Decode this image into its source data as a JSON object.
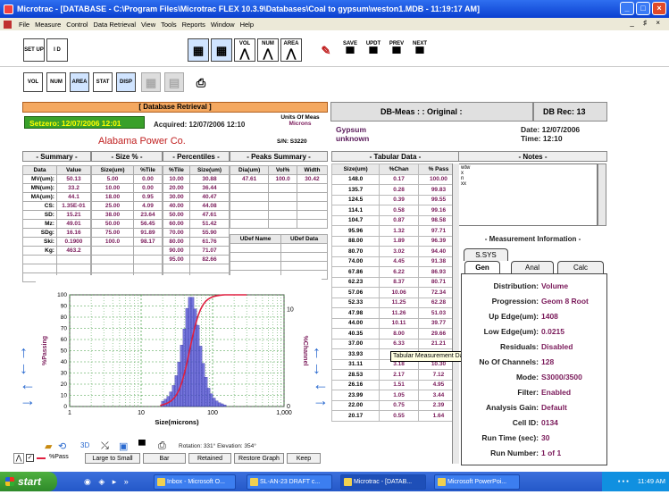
{
  "window": {
    "title": "Microtrac - [DATABASE - C:\\Program Files\\Microtrac FLEX 10.3.9\\Databases\\Coal to gypsum\\weston1.MDB - 11:19:17 AM]"
  },
  "menu": [
    "File",
    "Measure",
    "Control",
    "Data Retrieval",
    "View",
    "Tools",
    "Reports",
    "Window",
    "Help"
  ],
  "mdi_controls": "_ ♯ ×",
  "toolbar1": {
    "setup": "SET UP",
    "id": "I D",
    "vol": "VOL",
    "num": "NUM",
    "area": "AREA",
    "save": "SAVE",
    "updt": "UPDT",
    "prev": "PREV",
    "next": "NEXT"
  },
  "toolbar2": {
    "vol2": "VOL",
    "num2": "NUM",
    "area2": "AREA",
    "stat": "STAT",
    "disp": "DISP"
  },
  "database": {
    "header": "[ Database Retrieval ]",
    "setzero": "Setzero: 12/07/2006 12:01",
    "acquired": "Acquired: 12/07/2006  12:10",
    "units": "Units Of Meas",
    "units_value": "Microns",
    "company": "Alabama Power Co.",
    "sn": "S/N: S3220"
  },
  "sections": {
    "summary": "- Summary -",
    "size": "- Size % -",
    "percentiles": "- Percentiles -",
    "peaks": "- Peaks Summary -"
  },
  "summary": {
    "headers": [
      "Data",
      "Value"
    ],
    "rows": [
      [
        "MV(um):",
        "50.13"
      ],
      [
        "MN(um):",
        "33.2"
      ],
      [
        "MA(um):",
        "44.1"
      ],
      [
        "CS:",
        "1.35E-01"
      ],
      [
        "SD:",
        "15.21"
      ],
      [
        "Mz:",
        "49.01"
      ],
      [
        "SDg:",
        "16.16"
      ],
      [
        "Ski:",
        "0.1900"
      ],
      [
        "Kg:",
        "463.2"
      ]
    ]
  },
  "sizepct": {
    "headers": [
      "Size(um)",
      "%Tile"
    ],
    "rows": [
      [
        "5.00",
        "0.00"
      ],
      [
        "10.00",
        "0.00"
      ],
      [
        "18.00",
        "0.95"
      ],
      [
        "25.00",
        "4.09"
      ],
      [
        "38.00",
        "23.64"
      ],
      [
        "50.00",
        "56.45"
      ],
      [
        "75.00",
        "91.89"
      ],
      [
        "100.0",
        "98.17"
      ]
    ]
  },
  "percentiles": {
    "headers": [
      "%Tile",
      "Size(um)"
    ],
    "rows": [
      [
        "10.00",
        "30.88"
      ],
      [
        "20.00",
        "36.44"
      ],
      [
        "30.00",
        "40.47"
      ],
      [
        "40.00",
        "44.08"
      ],
      [
        "50.00",
        "47.61"
      ],
      [
        "60.00",
        "51.42"
      ],
      [
        "70.00",
        "55.90"
      ],
      [
        "80.00",
        "61.76"
      ],
      [
        "90.00",
        "71.07"
      ],
      [
        "95.00",
        "82.66"
      ]
    ]
  },
  "peaks": {
    "headers": [
      "Dia(um)",
      "Vol%",
      "Width"
    ],
    "rows": [
      [
        "47.61",
        "100.0",
        "30.42"
      ]
    ],
    "udef_headers": [
      "UDef Name",
      "UDef Data"
    ]
  },
  "right": {
    "dbmeas": "DB-Meas : : Original :",
    "dbrec": "DB Rec:  13",
    "sample1": "Gypsum",
    "sample2": "unknown",
    "date": "Date: 12/07/2006",
    "time": "Time: 12:10",
    "tabular_title": "- Tabular Data -",
    "notes_title": "- Notes -",
    "notes_lines": [
      "wtw",
      "x",
      "n",
      "xx"
    ]
  },
  "tabular": {
    "headers": [
      "Size(um)",
      "%Chan",
      "% Pass"
    ],
    "rows": [
      [
        "148.0",
        "0.17",
        "100.00"
      ],
      [
        "135.7",
        "0.28",
        "99.83"
      ],
      [
        "124.5",
        "0.39",
        "99.55"
      ],
      [
        "114.1",
        "0.58",
        "99.16"
      ],
      [
        "104.7",
        "0.87",
        "98.58"
      ],
      [
        "95.96",
        "1.32",
        "97.71"
      ],
      [
        "88.00",
        "1.89",
        "96.39"
      ],
      [
        "80.70",
        "3.02",
        "94.40"
      ],
      [
        "74.00",
        "4.45",
        "91.38"
      ],
      [
        "67.86",
        "6.22",
        "86.93"
      ],
      [
        "62.23",
        "8.37",
        "80.71"
      ],
      [
        "57.06",
        "10.06",
        "72.34"
      ],
      [
        "52.33",
        "11.25",
        "62.28"
      ],
      [
        "47.98",
        "11.26",
        "51.03"
      ],
      [
        "44.00",
        "10.11",
        "39.77"
      ],
      [
        "40.35",
        "8.00",
        "29.66"
      ],
      [
        "37.00",
        "6.33",
        "21.21"
      ],
      [
        "33.93",
        "4.58",
        "14.88"
      ],
      [
        "31.11",
        "3.18",
        "10.30"
      ],
      [
        "28.53",
        "2.17",
        "7.12"
      ],
      [
        "26.16",
        "1.51",
        "4.95"
      ],
      [
        "23.99",
        "1.05",
        "3.44"
      ],
      [
        "22.00",
        "0.75",
        "2.39"
      ],
      [
        "20.17",
        "0.55",
        "1.64"
      ]
    ]
  },
  "tooltip": "Tabular Measurement Data",
  "measinfo": {
    "title": "- Measurement Information -",
    "tab_ssys": "S.SYS",
    "tabs": [
      "Gen",
      "Anal",
      "Calc"
    ],
    "rows": [
      [
        "Distribution:",
        "Volume"
      ],
      [
        "Progression:",
        "Geom 8 Root"
      ],
      [
        "Up Edge(um):",
        "1408"
      ],
      [
        "Low Edge(um):",
        "0.0215"
      ],
      [
        "Residuals:",
        "Disabled"
      ],
      [
        "No Of Channels:",
        "128"
      ],
      [
        "Mode:",
        "S3000/3500"
      ],
      [
        "Filter:",
        "Enabled"
      ],
      [
        "Analysis Gain:",
        "Default"
      ],
      [
        "Cell ID:",
        "0134"
      ],
      [
        "Run Time (sec):",
        "30"
      ],
      [
        "Run Number:",
        "1 of 1"
      ]
    ]
  },
  "chart_data": {
    "type": "bar",
    "xlabel": "Size(microns)",
    "ylabel_left": "%Passing",
    "ylabel_right": "%Channel",
    "x_scale": "log",
    "xlim": [
      1,
      1000
    ],
    "ylim_left": [
      0,
      100
    ],
    "xticks": [
      "1",
      "10",
      "100",
      "1,000"
    ],
    "yticks_left": [
      "0",
      "10",
      "20",
      "30",
      "40",
      "50",
      "60",
      "70",
      "80",
      "90",
      "100"
    ],
    "yticks_right": [
      "0",
      "10"
    ],
    "grid": true,
    "series": [
      {
        "kind": "bars",
        "axis": "right",
        "color": "#4a4ad0",
        "x": [
          20.17,
          22.0,
          23.99,
          26.16,
          28.53,
          31.11,
          33.93,
          37.0,
          40.35,
          44.0,
          47.98,
          52.33,
          57.06,
          62.23,
          67.86,
          74.0,
          80.7,
          88.0,
          95.96,
          104.7,
          114.1,
          124.5,
          135.7,
          148.0
        ],
        "values": [
          0.55,
          0.75,
          1.05,
          1.51,
          2.17,
          3.18,
          4.58,
          6.33,
          8.0,
          10.11,
          11.26,
          11.25,
          10.06,
          8.37,
          6.22,
          4.45,
          3.02,
          1.89,
          1.32,
          0.87,
          0.58,
          0.39,
          0.28,
          0.17
        ]
      },
      {
        "kind": "line",
        "axis": "left",
        "color": "#e02040",
        "x": [
          18.5,
          20.17,
          22.0,
          23.99,
          26.16,
          28.53,
          31.11,
          33.93,
          37.0,
          40.35,
          44.0,
          47.98,
          52.33,
          57.06,
          62.23,
          67.86,
          74.0,
          80.7,
          88.0,
          95.96,
          104.7,
          114.1,
          124.5,
          135.7,
          148.0,
          300
        ],
        "values": [
          0.9,
          1.64,
          2.39,
          3.44,
          4.95,
          7.12,
          10.3,
          14.88,
          21.21,
          29.66,
          39.77,
          51.03,
          62.28,
          72.34,
          80.71,
          86.93,
          91.38,
          94.4,
          96.39,
          97.71,
          98.58,
          99.16,
          99.55,
          99.83,
          100.0,
          100.0
        ]
      }
    ]
  },
  "bottom": {
    "xpass": "%Pass",
    "large_small": "Large to Small",
    "bar": "Bar",
    "retained": "Retained",
    "restore": "Restore Graph",
    "keep": "Keep",
    "rotation": "Rotation: 331°  Elevation: 354°"
  },
  "taskbar": {
    "start": "start",
    "tasks": [
      "Inbox - Microsoft O...",
      "SL-AN-23 DRAFT c...",
      "Microtrac - [DATAB...",
      "Microsoft PowerPoi..."
    ],
    "clock": "11:49 AM"
  }
}
